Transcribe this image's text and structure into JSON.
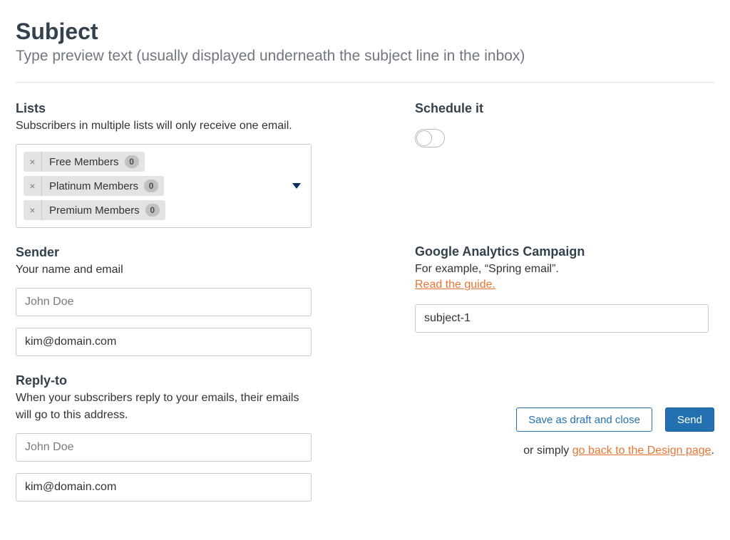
{
  "header": {
    "subject_placeholder": "Subject",
    "preview_placeholder": "Type preview text (usually displayed underneath the subject line in the inbox)"
  },
  "lists": {
    "title": "Lists",
    "subtitle": "Subscribers in multiple lists will only receive one email.",
    "items": [
      {
        "label": "Free Members",
        "count": "0"
      },
      {
        "label": "Platinum Members",
        "count": "0"
      },
      {
        "label": "Premium Members",
        "count": "0"
      }
    ]
  },
  "schedule": {
    "title": "Schedule it"
  },
  "sender": {
    "title": "Sender",
    "subtitle": "Your name and email",
    "name_placeholder": "John Doe",
    "name_value": "",
    "email_value": "kim@domain.com"
  },
  "analytics": {
    "title": "Google Analytics Campaign",
    "example": "For example, “Spring email”.",
    "guide_link": "Read the guide.",
    "value": "subject-1"
  },
  "reply_to": {
    "title": "Reply-to",
    "subtitle": "When your subscribers reply to your emails, their emails will go to this address.",
    "name_placeholder": "John Doe",
    "name_value": "",
    "email_value": "kim@domain.com"
  },
  "actions": {
    "save_draft": "Save as draft and close",
    "send": "Send",
    "or_prefix": "or simply ",
    "back_link": "go back to the Design page",
    "period": "."
  }
}
